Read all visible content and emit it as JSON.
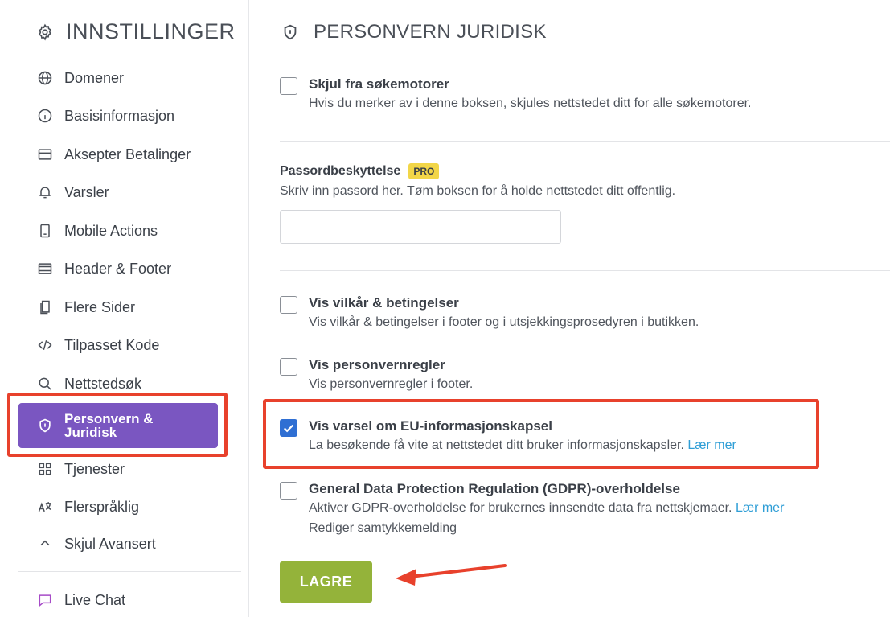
{
  "sidebar": {
    "title": "INNSTILLINGER",
    "items": [
      {
        "label": "Domener",
        "icon": "globe-icon"
      },
      {
        "label": "Basisinformasjon",
        "icon": "info-icon"
      },
      {
        "label": "Aksepter Betalinger",
        "icon": "card-icon"
      },
      {
        "label": "Varsler",
        "icon": "bell-icon"
      },
      {
        "label": "Mobile Actions",
        "icon": "mobile-icon"
      },
      {
        "label": "Header & Footer",
        "icon": "layout-icon"
      },
      {
        "label": "Flere Sider",
        "icon": "pages-icon"
      },
      {
        "label": "Tilpasset Kode",
        "icon": "code-icon"
      },
      {
        "label": "Nettstedsøk",
        "icon": "search-icon"
      },
      {
        "label": "Personvern & Juridisk",
        "icon": "shield-icon",
        "active": true
      },
      {
        "label": "Tjenester",
        "icon": "apps-icon"
      },
      {
        "label": "Flerspråklig",
        "icon": "translate-icon"
      },
      {
        "label": "Skjul Avansert",
        "icon": "chevron-up-icon"
      },
      {
        "label": "Live Chat",
        "icon": "chat-icon"
      }
    ]
  },
  "main": {
    "title": "PERSONVERN JURIDISK",
    "hide_search": {
      "title": "Skjul fra søkemotorer",
      "desc": "Hvis du merker av i denne boksen, skjules nettstedet ditt for alle søkemotorer.",
      "checked": false
    },
    "password": {
      "label": "Passordbeskyttelse",
      "badge": "PRO",
      "desc": "Skriv inn passord her. Tøm boksen for å holde nettstedet ditt offentlig.",
      "value": ""
    },
    "terms": {
      "title": "Vis vilkår & betingelser",
      "desc": "Vis vilkår & betingelser i footer og i utsjekkingsprosedyren i butikken.",
      "checked": false
    },
    "privacy": {
      "title": "Vis personvernregler",
      "desc": "Vis personvernregler i footer.",
      "checked": false
    },
    "cookie": {
      "title": "Vis varsel om EU-informasjonskapsel",
      "desc": "La besøkende få vite at nettstedet ditt bruker informasjonskapsler.",
      "link": "Lær mer",
      "checked": true
    },
    "gdpr": {
      "title": "General Data Protection Regulation (GDPR)-overholdelse",
      "desc": "Aktiver GDPR-overholdelse for brukernes innsendte data fra nettskjemaer.",
      "link": "Lær mer",
      "link2": "Rediger samtykkemelding",
      "checked": false
    },
    "save_label": "LAGRE"
  },
  "colors": {
    "accent": "#7a56c1",
    "highlight": "#e8412c",
    "save": "#94b33a",
    "checkbox": "#2f6fd3",
    "link": "#2f9ed6",
    "badge": "#f2d648"
  }
}
